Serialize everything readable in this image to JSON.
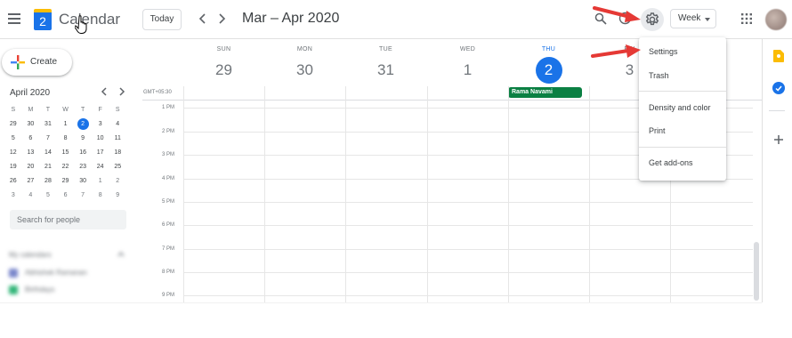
{
  "header": {
    "app_title": "Calendar",
    "logo_day": "2",
    "today_label": "Today",
    "prev_icon": "chevron-left-icon",
    "next_icon": "chevron-right-icon",
    "date_range": "Mar – Apr 2020",
    "view_label": "Week"
  },
  "sidebar": {
    "create_label": "Create",
    "mini_calendar": {
      "title": "April 2020",
      "weekdays": [
        "S",
        "M",
        "T",
        "W",
        "T",
        "F",
        "S"
      ],
      "weeks": [
        [
          "29",
          "30",
          "31",
          "1",
          "2",
          "3",
          "4"
        ],
        [
          "5",
          "6",
          "7",
          "8",
          "9",
          "10",
          "11"
        ],
        [
          "12",
          "13",
          "14",
          "15",
          "16",
          "17",
          "18"
        ],
        [
          "19",
          "20",
          "21",
          "22",
          "23",
          "24",
          "25"
        ],
        [
          "26",
          "27",
          "28",
          "29",
          "30",
          "1",
          "2"
        ],
        [
          "3",
          "4",
          "5",
          "6",
          "7",
          "8",
          "9"
        ]
      ],
      "today": "2"
    },
    "search_people_placeholder": "Search for people",
    "my_calendars_title": "My calendars",
    "calendars": [
      {
        "label": "Abhishek Ramanan",
        "color": "#7986cb"
      },
      {
        "label": "Birthdays",
        "color": "#33b679"
      }
    ]
  },
  "grid": {
    "timezone": "GMT+05:30",
    "days": [
      {
        "name": "SUN",
        "num": "29"
      },
      {
        "name": "MON",
        "num": "30"
      },
      {
        "name": "TUE",
        "num": "31"
      },
      {
        "name": "WED",
        "num": "1"
      },
      {
        "name": "THU",
        "num": "2",
        "today": true
      },
      {
        "name": "FRI",
        "num": "3"
      }
    ],
    "hours": [
      "1 PM",
      "2 PM",
      "3 PM",
      "4 PM",
      "5 PM",
      "6 PM",
      "7 PM",
      "8 PM",
      "9 PM"
    ],
    "event": {
      "title": "Rama Navami",
      "day": "THU",
      "color": "#0b8043"
    }
  },
  "menu": {
    "items": [
      "Settings",
      "Trash",
      "Density and color",
      "Print",
      "Get add-ons"
    ]
  },
  "colors": {
    "accent": "#1a73e8",
    "arrow": "#e53935"
  }
}
